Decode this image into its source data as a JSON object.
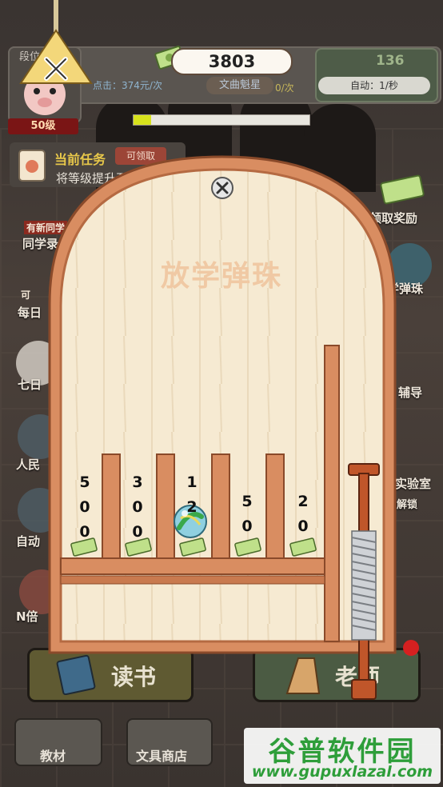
{
  "hud": {
    "rank_label": "段位",
    "level": "50级",
    "money": "3803",
    "click_rate": "点击：374元/次",
    "title_tag": "文曲魁星",
    "count_rate": "0/次",
    "coins": "136",
    "auto_rate": "自动：1/秒",
    "progress": 0.1
  },
  "task": {
    "title": "当前任务",
    "claim_label": "可领取",
    "desc": "将等级提升至"
  },
  "left_menu": [
    {
      "tag": "有新同学",
      "label": "同学录"
    },
    {
      "tag": "可",
      "label": "每日"
    },
    {
      "label": "七日"
    },
    {
      "label": "人民"
    },
    {
      "label": "自动"
    },
    {
      "label": "N倍"
    }
  ],
  "right_menu": [
    {
      "label": "领取奖励"
    },
    {
      "label": "学弹珠"
    },
    {
      "label": "辅导"
    },
    {
      "label": "实验室"
    },
    {
      "label": "解锁"
    }
  ],
  "bottom": {
    "read_label": "读书",
    "teacher_label": "老师",
    "textbook_label": "教材",
    "stationery_label": "文具商店"
  },
  "pinball": {
    "title": "放学弹珠",
    "slots": [
      {
        "score": "500"
      },
      {
        "score": "300"
      },
      {
        "score": "12"
      },
      {
        "score": "50"
      },
      {
        "score": "20"
      }
    ]
  },
  "colors": {
    "frame": "#d98d61",
    "frame_border": "#8a4a2a",
    "board": "#f6ead2",
    "marble": "#7fc3d8",
    "accent_green": "#2e9e3a"
  },
  "icons": [
    "lamp-close-icon",
    "money-icon",
    "close-icon",
    "marble-icon",
    "cash-icon",
    "spring-plunger-icon"
  ],
  "watermark": {
    "title": "谷普软件园",
    "url": "www.gupuxlazal.com"
  }
}
